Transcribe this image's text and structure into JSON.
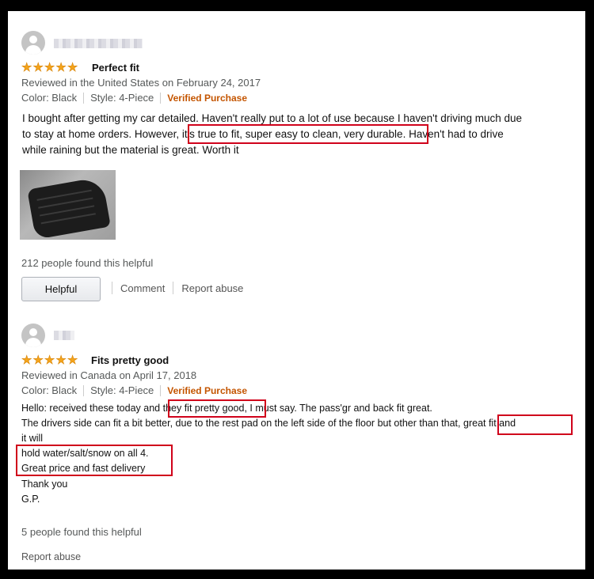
{
  "reviews": [
    {
      "stars": 5,
      "title": "Perfect fit",
      "reviewed": "Reviewed in the United States on February 24, 2017",
      "color": "Color: Black",
      "style": "Style: 4-Piece",
      "verified": "Verified Purchase",
      "body_line1": "I bought after getting my car detailed. Haven't really put to a lot of use because I haven't driving much due",
      "body_line2_a": "to stay at home orders. However, ",
      "body_line2_b": "it's true to fit, super easy to clean, very durable",
      "body_line2_c": ". Haven't had to drive",
      "body_line3": "while raining but the material is great. Worth it",
      "helpful_count": "212 people found this helpful",
      "helpful_button": "Helpful",
      "comment": "Comment",
      "report_abuse": "Report abuse"
    },
    {
      "stars": 5,
      "title": "Fits pretty good",
      "reviewed": "Reviewed in Canada on April 17, 2018",
      "color": "Color: Black",
      "style": "Style: 4-Piece",
      "verified": "Verified Purchase",
      "line1_a": "Hello: received these today and ",
      "line1_b": "they fit pretty good",
      "line1_c": ", I must say. The pass'gr and back fit great.",
      "line2_a": "The drivers side can fit a bit better, due to the rest pad on the left side of the floor but other than that,",
      "line2_b": "great fit and",
      "line3": "it will",
      "line4": "hold water/salt/snow on all 4.",
      "line5": "Great price and fast delivery",
      "line6": "Thank you",
      "line7": "G.P.",
      "helpful_count": "5 people found this helpful",
      "report_abuse": "Report abuse"
    }
  ],
  "colors": {
    "highlight": "#d0021b",
    "star": "#f4a41c",
    "verified": "#c45500"
  },
  "icons": {
    "avatar": "default-user-avatar-icon",
    "star": "star-icon"
  }
}
